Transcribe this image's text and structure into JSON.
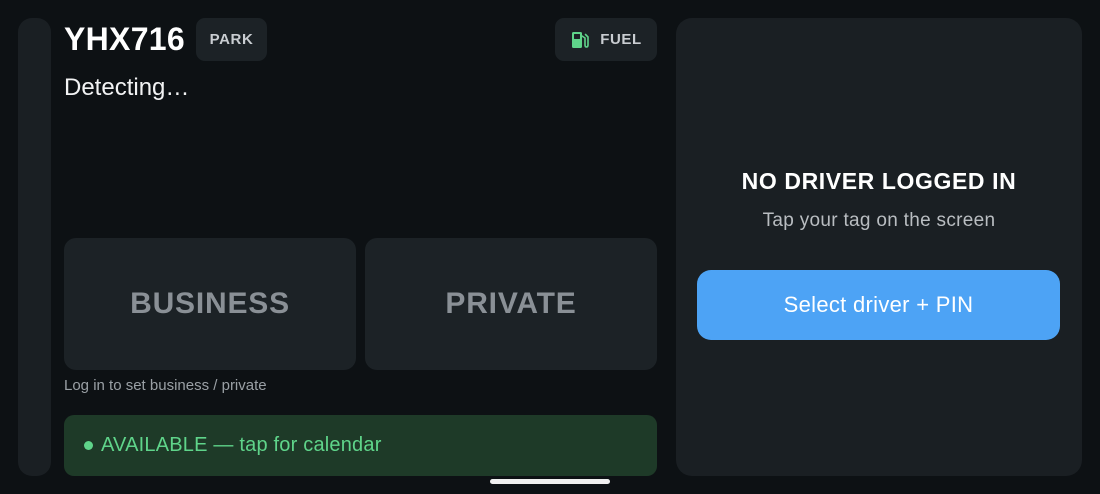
{
  "vehicle": {
    "plate": "YHX716",
    "gear_label": "PARK",
    "fuel_label": "FUEL",
    "fuel_icon": "fuel-pump-icon",
    "location_status": "Detecting…"
  },
  "trip_mode": {
    "business_label": "BUSINESS",
    "private_label": "PRIVATE",
    "hint": "Log in to set business / private"
  },
  "availability": {
    "text": "AVAILABLE — tap for calendar",
    "color": "#5fd48a"
  },
  "driver": {
    "title": "NO DRIVER LOGGED IN",
    "subtitle": "Tap your tag on the screen",
    "select_button_label": "Select driver + PIN"
  },
  "colors": {
    "background": "#0d1114",
    "card": "#1c2226",
    "accent": "#4da3f5",
    "available_bg": "#1e3a28"
  }
}
